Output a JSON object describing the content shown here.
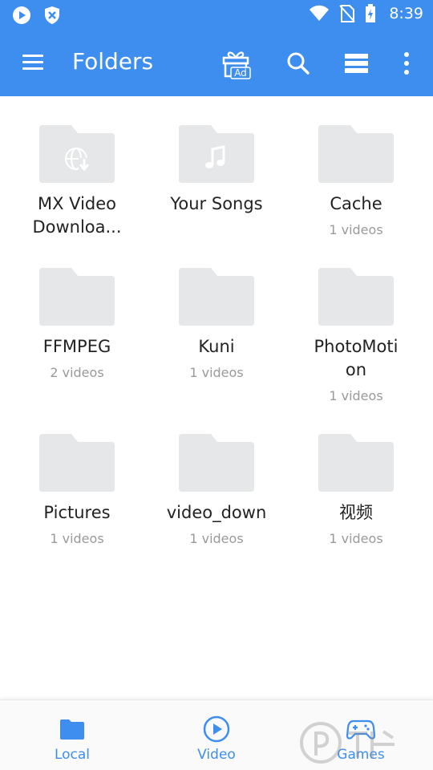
{
  "status_bar": {
    "time": "8:39",
    "left_icons": [
      "play-circle-icon",
      "shield-icon"
    ],
    "right_icons": [
      "wifi-icon",
      "no-sim-icon",
      "battery-charging-icon"
    ]
  },
  "app_bar": {
    "title": "Folders",
    "gift_badge": "Ad",
    "icons": [
      "menu-icon",
      "gift-icon",
      "search-icon",
      "view-list-icon",
      "more-vert-icon"
    ]
  },
  "folders": [
    {
      "name": "MX Video Downloa...",
      "name_lines": [
        "MX Video",
        "Downloa..."
      ],
      "count": "",
      "icon": "web-download-icon"
    },
    {
      "name": "Your Songs",
      "name_lines": [
        "Your Songs"
      ],
      "count": "",
      "icon": "music-note-icon"
    },
    {
      "name": "Cache",
      "name_lines": [
        "Cache"
      ],
      "count": "1 videos",
      "icon": ""
    },
    {
      "name": "FFMPEG",
      "name_lines": [
        "FFMPEG"
      ],
      "count": "2 videos",
      "icon": ""
    },
    {
      "name": "Kuni",
      "name_lines": [
        "Kuni"
      ],
      "count": "1 videos",
      "icon": ""
    },
    {
      "name": "PhotoMotion",
      "name_lines": [
        "PhotoMoti",
        "on"
      ],
      "count": "1 videos",
      "icon": ""
    },
    {
      "name": "Pictures",
      "name_lines": [
        "Pictures"
      ],
      "count": "1 videos",
      "icon": ""
    },
    {
      "name": "video_down",
      "name_lines": [
        "video_down"
      ],
      "count": "1 videos",
      "icon": ""
    },
    {
      "name": "视频",
      "name_lines": [
        "视频"
      ],
      "count": "1 videos",
      "icon": ""
    }
  ],
  "bottom_nav": {
    "items": [
      {
        "label": "Local",
        "icon": "folder-icon"
      },
      {
        "label": "Video",
        "icon": "play-circle-icon"
      },
      {
        "label": "Games",
        "icon": "gamepad-icon"
      }
    ]
  },
  "colors": {
    "primary": "#3e8ef0",
    "folder": "#e6e7e8",
    "folder_glyph": "#ffffff",
    "text": "#222222",
    "subtext": "#9a9a9a"
  }
}
